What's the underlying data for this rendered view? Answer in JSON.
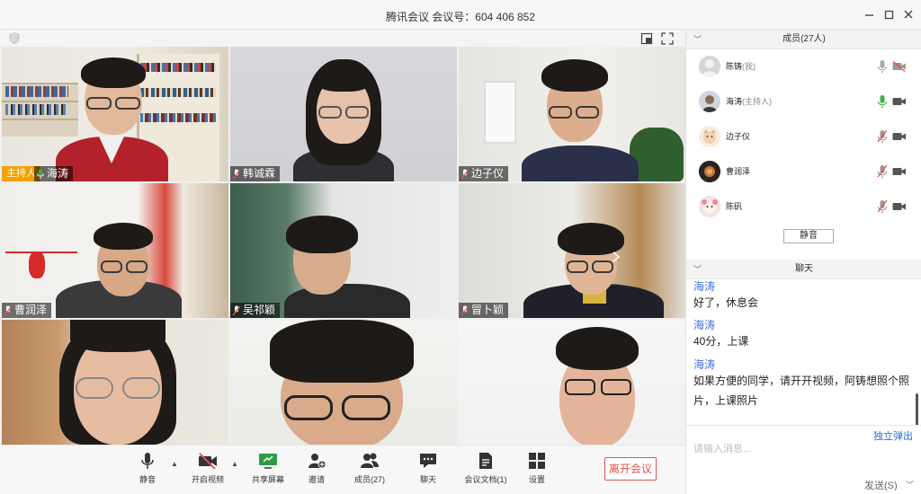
{
  "window": {
    "title": "腾讯会议 会议号：604 406 852",
    "minimize_icon": "minimize-icon",
    "maximize_icon": "maximize-icon",
    "close_icon": "close-icon"
  },
  "video": {
    "tiles": [
      {
        "name": "海涛",
        "host_tag": "主持人",
        "mic": "on"
      },
      {
        "name": "韩诚霖",
        "mic": "muted"
      },
      {
        "name": "边子仪",
        "mic": "muted"
      },
      {
        "name": "曹润泽",
        "mic": "muted"
      },
      {
        "name": "吴祁颖",
        "mic": "muted"
      },
      {
        "name": "冒卜颖",
        "mic": "muted"
      },
      {
        "name": "",
        "mic": "none"
      },
      {
        "name": "",
        "mic": "none"
      },
      {
        "name": "",
        "mic": "none"
      }
    ]
  },
  "toolbar": {
    "mute_label": "静音",
    "video_label": "开启视频",
    "share_label": "共享屏幕",
    "invite_label": "邀请",
    "members_label": "成员(27)",
    "chat_label": "聊天",
    "docs_label": "会议文档(1)",
    "settings_label": "设置",
    "leave_label": "离开会议"
  },
  "members": {
    "header": "成员(27人)",
    "items": [
      {
        "name": "陈铸",
        "role": "(我)",
        "mic": "off",
        "cam": "off"
      },
      {
        "name": "海涛",
        "role": "(主持人)",
        "mic": "on",
        "cam": "on"
      },
      {
        "name": "边子仪",
        "role": "",
        "mic": "muted",
        "cam": "on"
      },
      {
        "name": "曹润泽",
        "role": "",
        "mic": "muted",
        "cam": "on"
      },
      {
        "name": "陈矾",
        "role": "",
        "mic": "muted",
        "cam": "on"
      }
    ],
    "mute_all_label": "静音"
  },
  "chat": {
    "header": "聊天",
    "messages": [
      {
        "sender": "海涛",
        "text": "好了，休息会"
      },
      {
        "sender": "海涛",
        "text": "40分，上课"
      },
      {
        "sender": "海涛",
        "text": "如果方便的同学，请开开视频，阿铸想照个照片，上课照片"
      }
    ],
    "popout_label": "独立弹出",
    "input_placeholder": "请输入消息...",
    "send_label": "发送(S)"
  },
  "colors": {
    "host_tag": "#f2a100",
    "leave": "#e0524d",
    "link": "#3f6fd8",
    "mic_on": "#3cb34a",
    "muted": "#e0524d"
  }
}
